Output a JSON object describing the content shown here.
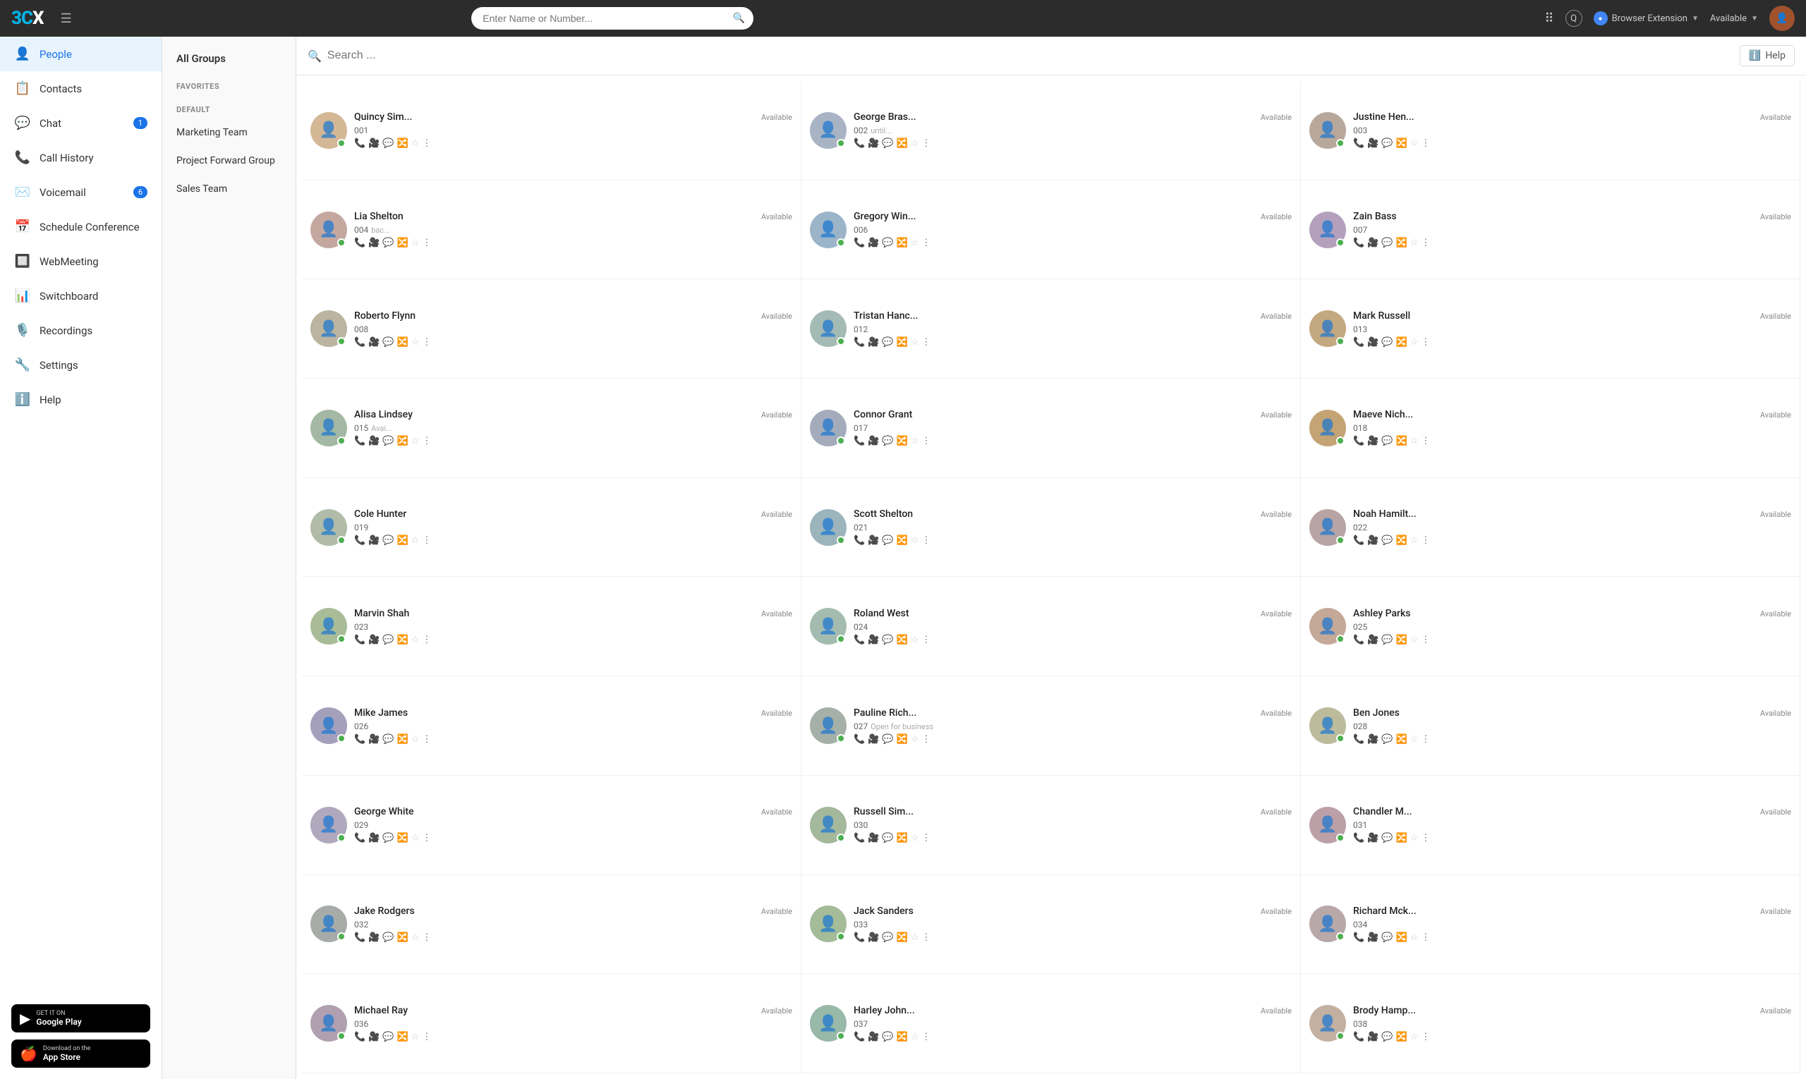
{
  "topbar": {
    "logo": "3CX",
    "search_placeholder": "Enter Name or Number...",
    "browser_extension_label": "Browser Extension",
    "availability_label": "Available",
    "q_label": "Q"
  },
  "sidebar": {
    "items": [
      {
        "id": "people",
        "label": "People",
        "icon": "👤",
        "active": true,
        "badge": null
      },
      {
        "id": "contacts",
        "label": "Contacts",
        "icon": "📋",
        "active": false,
        "badge": null
      },
      {
        "id": "chat",
        "label": "Chat",
        "icon": "💬",
        "active": false,
        "badge": "1"
      },
      {
        "id": "call-history",
        "label": "Call History",
        "icon": "📞",
        "active": false,
        "badge": null
      },
      {
        "id": "voicemail",
        "label": "Voicemail",
        "icon": "✉️",
        "active": false,
        "badge": "6"
      },
      {
        "id": "schedule-conference",
        "label": "Schedule Conference",
        "icon": "📅",
        "active": false,
        "badge": null
      },
      {
        "id": "webmeeting",
        "label": "WebMeeting",
        "icon": "🔲",
        "active": false,
        "badge": null
      },
      {
        "id": "switchboard",
        "label": "Switchboard",
        "icon": "📊",
        "active": false,
        "badge": null
      },
      {
        "id": "recordings",
        "label": "Recordings",
        "icon": "🎙️",
        "active": false,
        "badge": null
      },
      {
        "id": "settings",
        "label": "Settings",
        "icon": "🔧",
        "active": false,
        "badge": null
      },
      {
        "id": "help",
        "label": "Help",
        "icon": "ℹ️",
        "active": false,
        "badge": null
      }
    ],
    "google_play_label": "GET IT ON",
    "google_play_main": "Google Play",
    "app_store_label": "Download on the",
    "app_store_main": "App Store"
  },
  "groups": {
    "all_groups_label": "All Groups",
    "sections": [
      {
        "id": "favorites",
        "label": "FAVORITES",
        "type": "header"
      },
      {
        "id": "default",
        "label": "DEFAULT",
        "type": "header"
      },
      {
        "id": "marketing-team",
        "label": "Marketing Team",
        "type": "item"
      },
      {
        "id": "project-forward",
        "label": "Project Forward Group",
        "type": "item"
      },
      {
        "id": "sales-team",
        "label": "Sales Team",
        "type": "item"
      }
    ]
  },
  "contacts_header": {
    "search_placeholder": "Search ...",
    "help_label": "Help"
  },
  "contacts": [
    {
      "name": "Quincy Sim...",
      "ext": "001",
      "status": "Available",
      "sub": ""
    },
    {
      "name": "George Bras...",
      "ext": "002",
      "status": "Available",
      "sub": "until..."
    },
    {
      "name": "Justine Hen...",
      "ext": "003",
      "status": "Available",
      "sub": ""
    },
    {
      "name": "Lia Shelton",
      "ext": "004",
      "status": "Available",
      "sub": "bac..."
    },
    {
      "name": "Gregory Win...",
      "ext": "006",
      "status": "Available",
      "sub": ""
    },
    {
      "name": "Zain Bass",
      "ext": "007",
      "status": "Available",
      "sub": ""
    },
    {
      "name": "Roberto Flynn",
      "ext": "008",
      "status": "Available",
      "sub": ""
    },
    {
      "name": "Tristan Hanc...",
      "ext": "012",
      "status": "Available",
      "sub": ""
    },
    {
      "name": "Mark Russell",
      "ext": "013",
      "status": "Available",
      "sub": ""
    },
    {
      "name": "Alisa Lindsey",
      "ext": "015",
      "status": "Available",
      "sub": "Avai..."
    },
    {
      "name": "Connor Grant",
      "ext": "017",
      "status": "Available",
      "sub": ""
    },
    {
      "name": "Maeve Nich...",
      "ext": "018",
      "status": "Available",
      "sub": ""
    },
    {
      "name": "Cole Hunter",
      "ext": "019",
      "status": "Available",
      "sub": ""
    },
    {
      "name": "Scott Shelton",
      "ext": "021",
      "status": "Available",
      "sub": ""
    },
    {
      "name": "Noah Hamilt...",
      "ext": "022",
      "status": "Available",
      "sub": ""
    },
    {
      "name": "Marvin Shah",
      "ext": "023",
      "status": "Available",
      "sub": ""
    },
    {
      "name": "Roland West",
      "ext": "024",
      "status": "Available",
      "sub": ""
    },
    {
      "name": "Ashley Parks",
      "ext": "025",
      "status": "Available",
      "sub": ""
    },
    {
      "name": "Mike James",
      "ext": "026",
      "status": "Available",
      "sub": ""
    },
    {
      "name": "Pauline Rich...",
      "ext": "027",
      "status": "Available",
      "sub": "Open for business"
    },
    {
      "name": "Ben Jones",
      "ext": "028",
      "status": "Available",
      "sub": ""
    },
    {
      "name": "George White",
      "ext": "029",
      "status": "Available",
      "sub": ""
    },
    {
      "name": "Russell Sim...",
      "ext": "030",
      "status": "Available",
      "sub": ""
    },
    {
      "name": "Chandler M...",
      "ext": "031",
      "status": "Available",
      "sub": ""
    },
    {
      "name": "Jake Rodgers",
      "ext": "032",
      "status": "Available",
      "sub": ""
    },
    {
      "name": "Jack Sanders",
      "ext": "033",
      "status": "Available",
      "sub": ""
    },
    {
      "name": "Richard Mck...",
      "ext": "034",
      "status": "Available",
      "sub": ""
    },
    {
      "name": "Michael Ray",
      "ext": "036",
      "status": "Available",
      "sub": ""
    },
    {
      "name": "Harley John...",
      "ext": "037",
      "status": "Available",
      "sub": ""
    },
    {
      "name": "Brody Hamp...",
      "ext": "038",
      "status": "Available",
      "sub": ""
    }
  ],
  "avatar_colors": [
    "#e8c39e",
    "#b0b8c8",
    "#c4b8a8",
    "#d4a8a0",
    "#a8b8d0",
    "#b8a8c0",
    "#c0b8a0",
    "#a8c0b8",
    "#c8b090",
    "#b0c0a8",
    "#a8b0c8",
    "#c8a888",
    "#b8c8b0",
    "#a0b8c8",
    "#c0a8a8",
    "#b0c8a0",
    "#a8c8b8",
    "#c8b0a0",
    "#b0a8c8",
    "#a8b8b0",
    "#c0c0a8",
    "#b8b0c8",
    "#a8c0a8",
    "#c8a8b0",
    "#b0b8b0",
    "#a8c8a0",
    "#c0b8b0",
    "#b8a8b8",
    "#a0c0b0",
    "#c8b8a8"
  ]
}
